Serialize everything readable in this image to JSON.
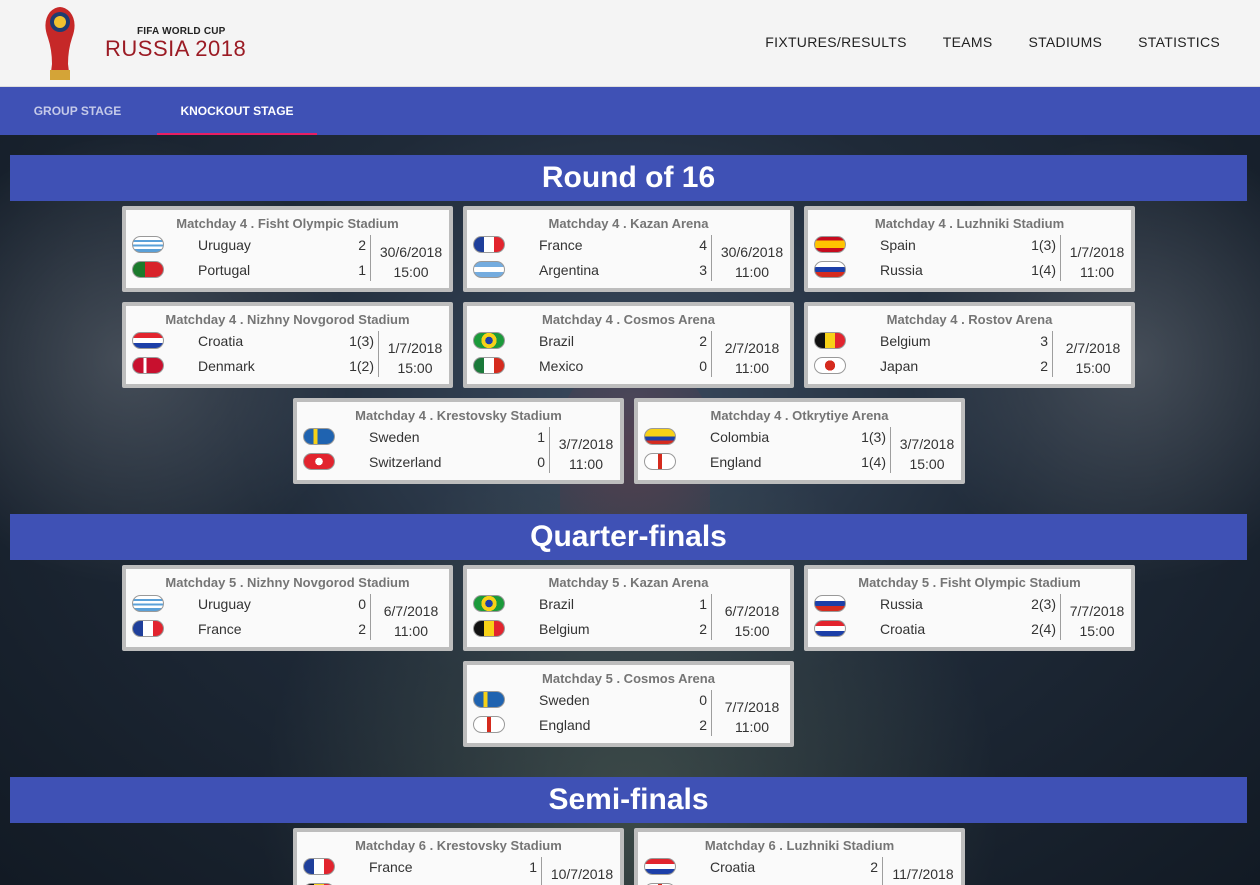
{
  "brand": {
    "small": "FIFA WORLD CUP",
    "big": "RUSSIA 2018"
  },
  "nav": [
    "FIXTURES/RESULTS",
    "TEAMS",
    "STADIUMS",
    "STATISTICS"
  ],
  "tabs": {
    "group": "GROUP STAGE",
    "knockout": "KNOCKOUT STAGE"
  },
  "sections": {
    "r16": "Round of 16",
    "qf": "Quarter-finals",
    "sf": "Semi-finals"
  },
  "matches": [
    {
      "title": "Matchday 4 . Fisht Olympic Stadium",
      "home": "Uruguay",
      "home_score": "2",
      "away": "Portugal",
      "away_score": "1",
      "date": "30/6/2018",
      "time": "15:00",
      "home_flag": "uruguay",
      "away_flag": "portugal"
    },
    {
      "title": "Matchday 4 . Kazan Arena",
      "home": "France",
      "home_score": "4",
      "away": "Argentina",
      "away_score": "3",
      "date": "30/6/2018",
      "time": "11:00",
      "home_flag": "france",
      "away_flag": "argentina"
    },
    {
      "title": "Matchday 4 . Luzhniki Stadium",
      "home": "Spain",
      "home_score": "1(3)",
      "away": "Russia",
      "away_score": "1(4)",
      "date": "1/7/2018",
      "time": "11:00",
      "home_flag": "spain",
      "away_flag": "russia"
    },
    {
      "title": "Matchday 4 . Nizhny Novgorod Stadium",
      "home": "Croatia",
      "home_score": "1(3)",
      "away": "Denmark",
      "away_score": "1(2)",
      "date": "1/7/2018",
      "time": "15:00",
      "home_flag": "croatia",
      "away_flag": "denmark"
    },
    {
      "title": "Matchday 4 . Cosmos Arena",
      "home": "Brazil",
      "home_score": "2",
      "away": "Mexico",
      "away_score": "0",
      "date": "2/7/2018",
      "time": "11:00",
      "home_flag": "brazil",
      "away_flag": "mexico"
    },
    {
      "title": "Matchday 4 . Rostov Arena",
      "home": "Belgium",
      "home_score": "3",
      "away": "Japan",
      "away_score": "2",
      "date": "2/7/2018",
      "time": "15:00",
      "home_flag": "belgium",
      "away_flag": "japan"
    },
    {
      "title": "Matchday 4 . Krestovsky Stadium",
      "home": "Sweden",
      "home_score": "1",
      "away": "Switzerland",
      "away_score": "0",
      "date": "3/7/2018",
      "time": "11:00",
      "home_flag": "sweden",
      "away_flag": "switzerland"
    },
    {
      "title": "Matchday 4 . Otkrytiye Arena",
      "home": "Colombia",
      "home_score": "1(3)",
      "away": "England",
      "away_score": "1(4)",
      "date": "3/7/2018",
      "time": "15:00",
      "home_flag": "colombia",
      "away_flag": "england"
    },
    {
      "title": "Matchday 5 . Nizhny Novgorod Stadium",
      "home": "Uruguay",
      "home_score": "0",
      "away": "France",
      "away_score": "2",
      "date": "6/7/2018",
      "time": "11:00",
      "home_flag": "uruguay",
      "away_flag": "france"
    },
    {
      "title": "Matchday 5 . Kazan Arena",
      "home": "Brazil",
      "home_score": "1",
      "away": "Belgium",
      "away_score": "2",
      "date": "6/7/2018",
      "time": "15:00",
      "home_flag": "brazil",
      "away_flag": "belgium"
    },
    {
      "title": "Matchday 5 . Fisht Olympic Stadium",
      "home": "Russia",
      "home_score": "2(3)",
      "away": "Croatia",
      "away_score": "2(4)",
      "date": "7/7/2018",
      "time": "15:00",
      "home_flag": "russia",
      "away_flag": "croatia"
    },
    {
      "title": "Matchday 5 . Cosmos Arena",
      "home": "Sweden",
      "home_score": "0",
      "away": "England",
      "away_score": "2",
      "date": "7/7/2018",
      "time": "11:00",
      "home_flag": "sweden",
      "away_flag": "england"
    },
    {
      "title": "Matchday 6 . Krestovsky Stadium",
      "home": "France",
      "home_score": "1",
      "away": "",
      "away_score": "",
      "date": "10/7/2018",
      "time": "",
      "home_flag": "france",
      "away_flag": "belgium"
    },
    {
      "title": "Matchday 6 . Luzhniki Stadium",
      "home": "Croatia",
      "home_score": "2",
      "away": "",
      "away_score": "",
      "date": "11/7/2018",
      "time": "",
      "home_flag": "croatia",
      "away_flag": "england"
    }
  ],
  "flags": {
    "uruguay": "linear-gradient(#fff 0 20%, #5aa0d8 20% 35%, #fff 35% 50%, #5aa0d8 50% 65%, #fff 65% 80%, #5aa0d8 80% 100%)",
    "portugal": "linear-gradient(90deg, #1b7a2c 0 40%, #d8232a 40% 100%)",
    "france": "linear-gradient(90deg, #1f3f9b 0 33%, #fff 33% 66%, #e2242e 66% 100%)",
    "argentina": "linear-gradient(#74acdf 0 33%, #fff 33% 66%, #74acdf 66% 100%)",
    "spain": "linear-gradient(#c60b1e 0 25%, #ffc400 25% 75%, #c60b1e 75% 100%)",
    "russia": "linear-gradient(#fff 0 33%, #1c3fa8 33% 66%, #d52b1e 66% 100%)",
    "croatia": "linear-gradient(#e2242e 0 33%, #fff 33% 66%, #1c3fa8 66% 100%)",
    "denmark": "linear-gradient(90deg, #c8102e 0 35%, #fff 35% 45%, #c8102e 45% 100%)",
    "brazil": "radial-gradient(circle, #1c3fa8 0 22%, #f7d117 23% 45%, #1b9a3a 46% 100%)",
    "mexico": "linear-gradient(90deg, #1b7a3a 0 33%, #fff 33% 66%, #d52b1e 66% 100%)",
    "belgium": "linear-gradient(90deg, #111 0 33%, #f7d117 33% 66%, #e2242e 66% 100%)",
    "japan": "radial-gradient(circle, #d52b1e 0 30%, #fff 31% 100%)",
    "sweden": "linear-gradient(90deg, #1f63b0 0 32%, #f7d117 32% 45%, #1f63b0 45% 100%)",
    "switzerland": "radial-gradient(circle, #fff 0 22%, #e2242e 23% 100%)",
    "colombia": "linear-gradient(#f7d117 0 50%, #1c3fa8 50% 75%, #d52b1e 75% 100%)",
    "england": "linear-gradient(90deg, #fff 0 44%, #d52b1e 44% 56%, #fff 56% 100%)"
  }
}
